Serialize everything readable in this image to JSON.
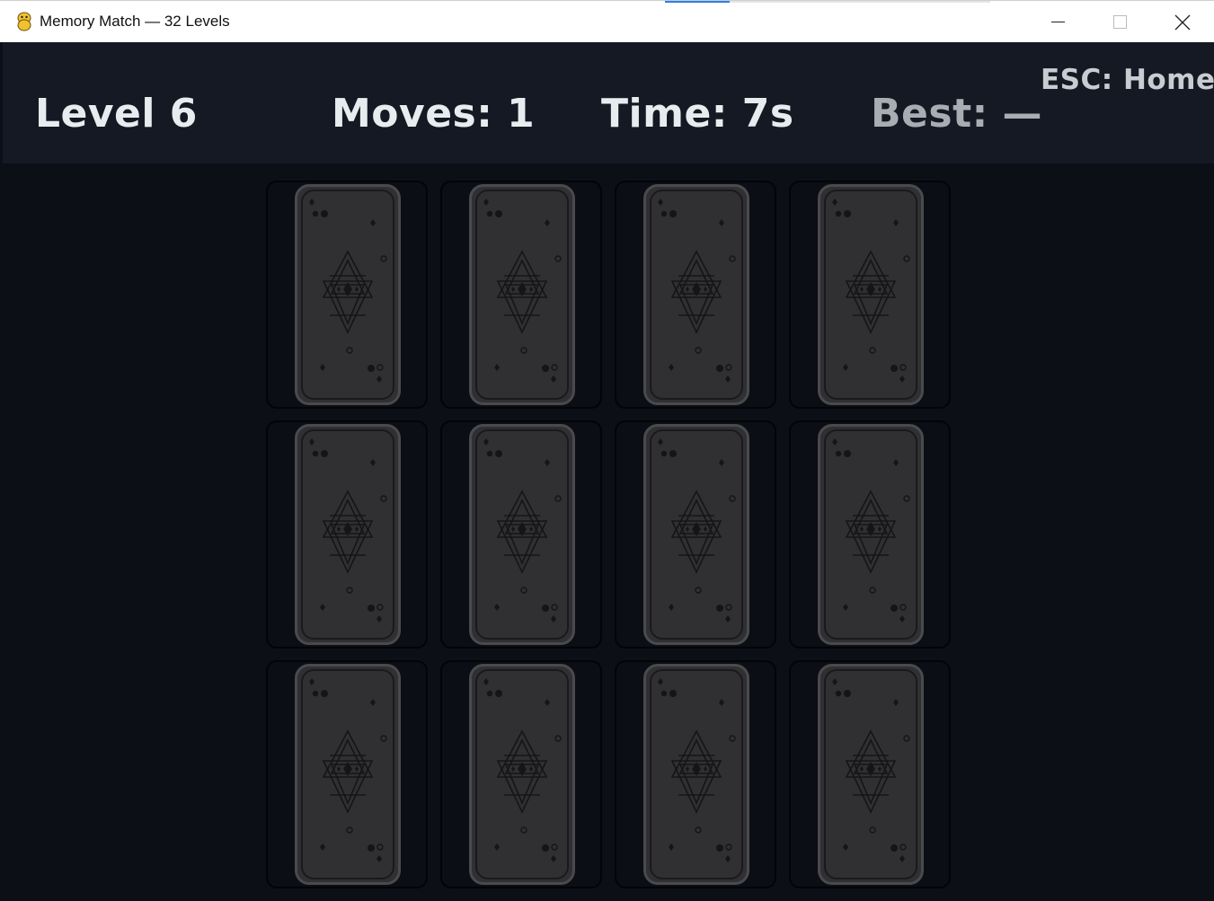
{
  "window": {
    "title": "Memory Match — 32 Levels",
    "icon": "pygame-snake-icon",
    "buttons": [
      "minimize",
      "maximize",
      "close"
    ]
  },
  "hud": {
    "level": "Level 6",
    "moves": "Moves: 1",
    "time": "Time: 7s",
    "best": "Best: —",
    "esc_hint": "ESC: Home"
  },
  "board": {
    "rows": 3,
    "columns": 4,
    "cards": [
      {
        "state": "face-down"
      },
      {
        "state": "face-down"
      },
      {
        "state": "face-down"
      },
      {
        "state": "face-down"
      },
      {
        "state": "face-down"
      },
      {
        "state": "face-down"
      },
      {
        "state": "face-down"
      },
      {
        "state": "face-down"
      },
      {
        "state": "face-down"
      },
      {
        "state": "face-down"
      },
      {
        "state": "face-down"
      },
      {
        "state": "face-down"
      }
    ]
  },
  "colors": {
    "background": "#0c0f16",
    "hud_background": "#141923",
    "hud_text": "#e9ecef",
    "best_text": "#a9adb3",
    "card_back": "#303033",
    "card_border": "#4a4a4e"
  }
}
